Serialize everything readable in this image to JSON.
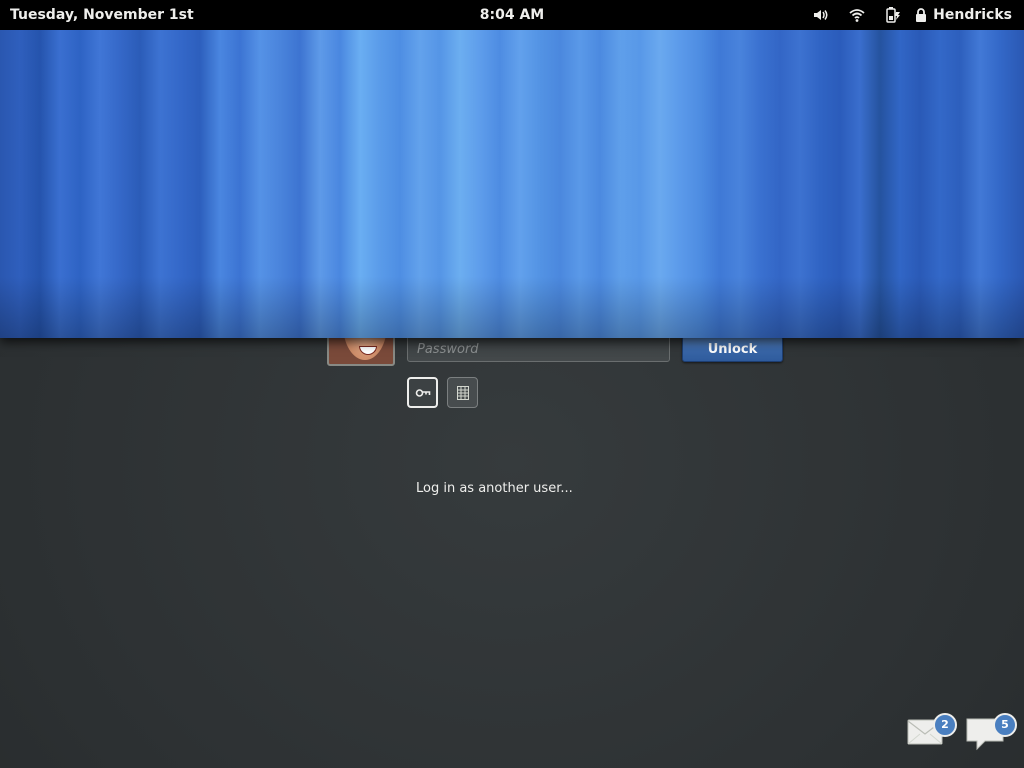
{
  "topbar": {
    "date": "Tuesday, November 1st",
    "time": "8:04 AM",
    "status_icons": [
      "volume-icon",
      "wifi-icon",
      "battery-icon"
    ],
    "user_name": "Hendricks",
    "user_icon": "lock-icon"
  },
  "login": {
    "password_placeholder": "Password",
    "unlock_label": "Unlock",
    "auth_methods": [
      "key-icon",
      "keypad-icon"
    ],
    "other_user_label": "Log in as another user..."
  },
  "tray": {
    "mail_count": "2",
    "chat_count": "5"
  },
  "colors": {
    "background": "#2e3436",
    "topbar": "#000000",
    "accent": "#3a68aa",
    "curtain": "#4a84dc"
  }
}
